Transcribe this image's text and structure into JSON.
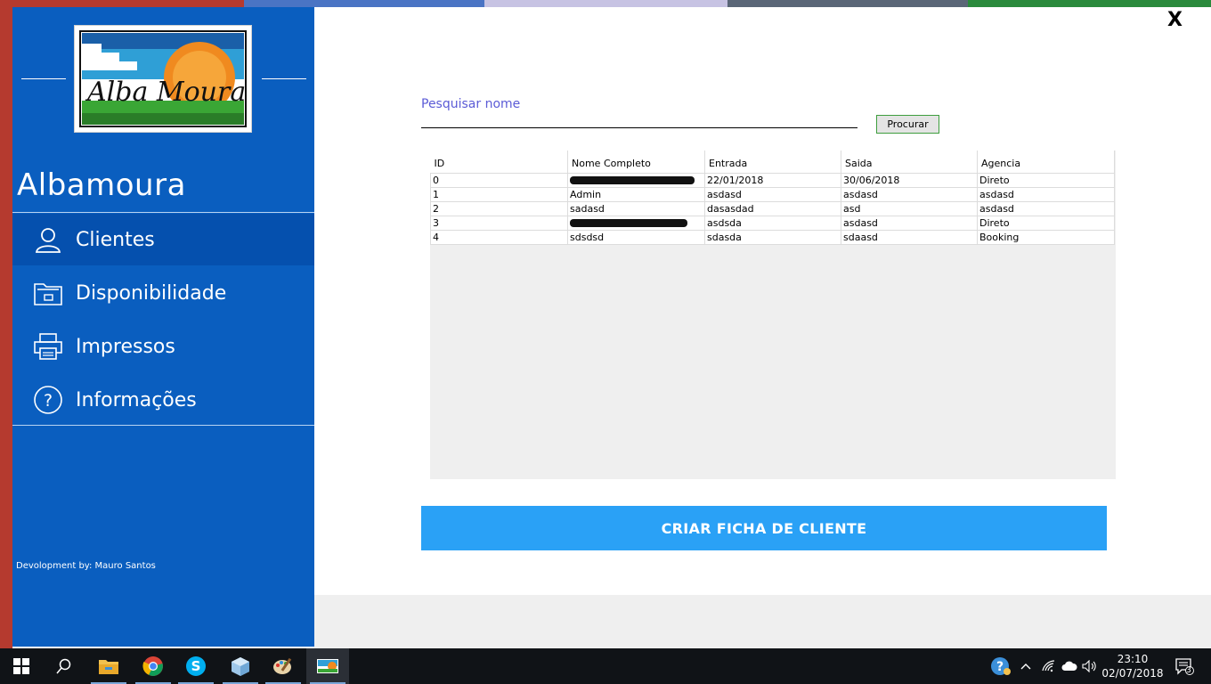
{
  "window": {
    "close_label": "X"
  },
  "logo": {
    "text": "Alba Moura"
  },
  "sidebar": {
    "app_title": "Albamoura",
    "items": [
      {
        "label": "Clientes",
        "icon": "user-icon",
        "active": true
      },
      {
        "label": "Disponibilidade",
        "icon": "folder-icon",
        "active": false
      },
      {
        "label": "Impressos",
        "icon": "printer-icon",
        "active": false
      },
      {
        "label": "Informações",
        "icon": "question-icon",
        "active": false
      }
    ],
    "credit": "Devolopment by: Mauro Santos"
  },
  "search": {
    "label": "Pesquisar nome",
    "value": "",
    "button_label": "Procurar"
  },
  "table": {
    "columns": [
      "ID",
      "Nome Completo",
      "Entrada",
      "Saida",
      "Agencia"
    ],
    "rows": [
      [
        "0",
        "",
        "22/01/2018",
        "30/06/2018",
        "Direto"
      ],
      [
        "1",
        "Admin",
        "asdasd",
        "asdasd",
        "asdasd"
      ],
      [
        "2",
        "sadasd",
        "dasasdad",
        "asd",
        "asdasd"
      ],
      [
        "3",
        "",
        "asdsda",
        "asdasd",
        "Direto"
      ],
      [
        "4",
        "sdsdsd",
        "sdasda",
        "sdaasd",
        "Booking"
      ]
    ]
  },
  "create_button": {
    "label": "CRIAR FICHA DE CLIENTE"
  },
  "taskbar": {
    "icons": [
      "windows-start-icon",
      "search-icon",
      "file-explorer-icon",
      "chrome-icon",
      "skype-icon",
      "box-app-icon",
      "paint-icon",
      "albamoura-app-icon"
    ],
    "time": "23:10",
    "date": "02/07/2018",
    "notification_count": "3"
  },
  "colors": {
    "sidebar": "#0a5ebf",
    "sidebar_active": "#0550ae",
    "accent_button": "#2aa1f6",
    "search_label": "#5b5bd6"
  }
}
